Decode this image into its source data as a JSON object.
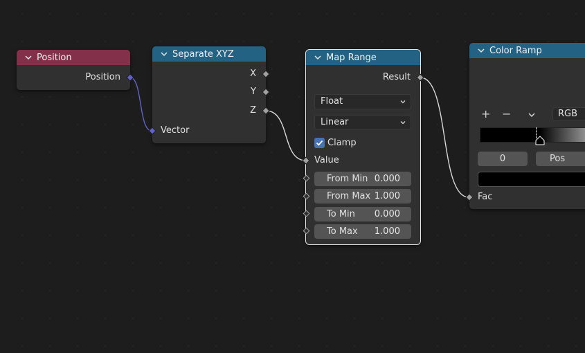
{
  "nodes": {
    "position": {
      "title": "Position",
      "header_color": "#83314a",
      "output_label": "Position"
    },
    "separate_xyz": {
      "title": "Separate XYZ",
      "header_color": "#246283",
      "outputs": [
        "X",
        "Y",
        "Z"
      ],
      "input_label": "Vector"
    },
    "map_range": {
      "title": "Map Range",
      "header_color": "#246283",
      "output_label": "Result",
      "data_type": "Float",
      "interpolation": "Linear",
      "clamp_label": "Clamp",
      "clamp_checked": true,
      "value_label": "Value",
      "fields": [
        {
          "label": "From Min",
          "value": "0.000"
        },
        {
          "label": "From Max",
          "value": "1.000"
        },
        {
          "label": "To Min",
          "value": "0.000"
        },
        {
          "label": "To Max",
          "value": "1.000"
        }
      ]
    },
    "color_ramp": {
      "title": "Color Ramp",
      "header_color": "#246283",
      "add_label": "+",
      "remove_label": "−",
      "color_mode": "RGB",
      "stop_index": "0",
      "pos_label": "Pos",
      "input_label": "Fac"
    }
  },
  "colors": {
    "background": "#1d1d1d",
    "node_body": "#303030",
    "float_socket": "#a1a1a1",
    "vector_socket": "#6363c7",
    "link": "#d8d8d8"
  }
}
